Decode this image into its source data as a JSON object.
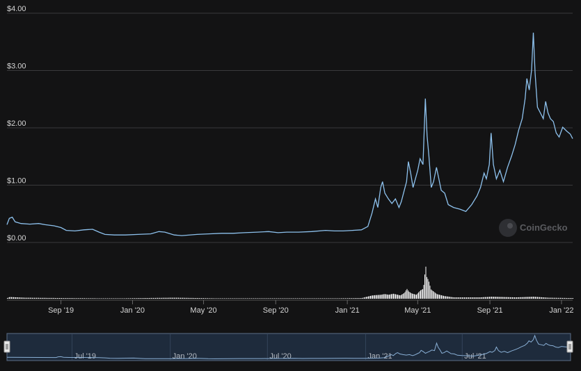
{
  "colors": {
    "background": "#131314",
    "price_line": "#8ec2ee",
    "volume_bars": "#ffffff",
    "grid": "#3a3a3c",
    "navigator_fill": "#1e2b3c",
    "navigator_border": "#5b6c86"
  },
  "watermark": {
    "text": "CoinGecko",
    "icon": "coingecko-logo-icon"
  },
  "chart_data": {
    "type": "line",
    "ylim": [
      0,
      4
    ],
    "y_ticks": [
      "$0.00",
      "$1.00",
      "$2.00",
      "$3.00",
      "$4.00"
    ],
    "x_ticks": [
      "Sep '19",
      "Jan '20",
      "May '20",
      "Sep '20",
      "Jan '21",
      "May '21",
      "Sep '21",
      "Jan '22"
    ],
    "xlim": [
      "2019-06-01",
      "2022-01-20"
    ],
    "grid": true,
    "series": [
      {
        "values_type": "price",
        "points": [
          [
            "2019-06-01",
            0.25
          ],
          [
            "2019-06-05",
            0.36
          ],
          [
            "2019-06-10",
            0.38
          ],
          [
            "2019-06-15",
            0.3
          ],
          [
            "2019-06-25",
            0.27
          ],
          [
            "2019-07-10",
            0.26
          ],
          [
            "2019-07-25",
            0.27
          ],
          [
            "2019-08-05",
            0.25
          ],
          [
            "2019-08-20",
            0.23
          ],
          [
            "2019-09-01",
            0.2
          ],
          [
            "2019-09-10",
            0.15
          ],
          [
            "2019-09-25",
            0.14
          ],
          [
            "2019-10-10",
            0.16
          ],
          [
            "2019-10-25",
            0.17
          ],
          [
            "2019-11-05",
            0.12
          ],
          [
            "2019-11-15",
            0.08
          ],
          [
            "2019-12-01",
            0.07
          ],
          [
            "2019-12-20",
            0.07
          ],
          [
            "2020-01-10",
            0.08
          ],
          [
            "2020-02-01",
            0.09
          ],
          [
            "2020-02-15",
            0.13
          ],
          [
            "2020-02-25",
            0.12
          ],
          [
            "2020-03-12",
            0.07
          ],
          [
            "2020-03-25",
            0.06
          ],
          [
            "2020-04-20",
            0.08
          ],
          [
            "2020-05-10",
            0.09
          ],
          [
            "2020-06-01",
            0.1
          ],
          [
            "2020-06-20",
            0.1
          ],
          [
            "2020-07-10",
            0.11
          ],
          [
            "2020-08-01",
            0.12
          ],
          [
            "2020-08-20",
            0.13
          ],
          [
            "2020-09-05",
            0.11
          ],
          [
            "2020-09-20",
            0.12
          ],
          [
            "2020-10-10",
            0.12
          ],
          [
            "2020-11-01",
            0.13
          ],
          [
            "2020-11-25",
            0.15
          ],
          [
            "2020-12-10",
            0.14
          ],
          [
            "2020-12-25",
            0.14
          ],
          [
            "2021-01-10",
            0.15
          ],
          [
            "2021-01-25",
            0.16
          ],
          [
            "2021-02-05",
            0.22
          ],
          [
            "2021-02-12",
            0.45
          ],
          [
            "2021-02-18",
            0.7
          ],
          [
            "2021-02-22",
            0.55
          ],
          [
            "2021-02-27",
            0.9
          ],
          [
            "2021-03-02",
            1.0
          ],
          [
            "2021-03-06",
            0.8
          ],
          [
            "2021-03-12",
            0.7
          ],
          [
            "2021-03-18",
            0.62
          ],
          [
            "2021-03-24",
            0.7
          ],
          [
            "2021-03-30",
            0.55
          ],
          [
            "2021-04-03",
            0.65
          ],
          [
            "2021-04-08",
            0.85
          ],
          [
            "2021-04-12",
            1.0
          ],
          [
            "2021-04-15",
            1.35
          ],
          [
            "2021-04-19",
            1.15
          ],
          [
            "2021-04-23",
            0.9
          ],
          [
            "2021-04-27",
            1.05
          ],
          [
            "2021-05-01",
            1.2
          ],
          [
            "2021-05-05",
            1.4
          ],
          [
            "2021-05-10",
            1.3
          ],
          [
            "2021-05-14",
            2.45
          ],
          [
            "2021-05-17",
            1.8
          ],
          [
            "2021-05-20",
            1.45
          ],
          [
            "2021-05-24",
            0.9
          ],
          [
            "2021-05-28",
            1.0
          ],
          [
            "2021-06-02",
            1.25
          ],
          [
            "2021-06-06",
            1.05
          ],
          [
            "2021-06-10",
            0.85
          ],
          [
            "2021-06-16",
            0.8
          ],
          [
            "2021-06-22",
            0.6
          ],
          [
            "2021-07-01",
            0.55
          ],
          [
            "2021-07-12",
            0.52
          ],
          [
            "2021-07-22",
            0.48
          ],
          [
            "2021-08-01",
            0.6
          ],
          [
            "2021-08-10",
            0.75
          ],
          [
            "2021-08-16",
            0.9
          ],
          [
            "2021-08-22",
            1.15
          ],
          [
            "2021-08-26",
            1.05
          ],
          [
            "2021-08-31",
            1.3
          ],
          [
            "2021-09-03",
            1.85
          ],
          [
            "2021-09-07",
            1.3
          ],
          [
            "2021-09-12",
            1.05
          ],
          [
            "2021-09-18",
            1.2
          ],
          [
            "2021-09-24",
            1.0
          ],
          [
            "2021-10-01",
            1.25
          ],
          [
            "2021-10-08",
            1.45
          ],
          [
            "2021-10-14",
            1.65
          ],
          [
            "2021-10-20",
            1.9
          ],
          [
            "2021-10-26",
            2.1
          ],
          [
            "2021-10-31",
            2.45
          ],
          [
            "2021-11-03",
            2.8
          ],
          [
            "2021-11-07",
            2.6
          ],
          [
            "2021-11-11",
            2.95
          ],
          [
            "2021-11-14",
            3.6
          ],
          [
            "2021-11-17",
            2.9
          ],
          [
            "2021-11-21",
            2.3
          ],
          [
            "2021-11-26",
            2.2
          ],
          [
            "2021-12-01",
            2.1
          ],
          [
            "2021-12-05",
            2.4
          ],
          [
            "2021-12-09",
            2.2
          ],
          [
            "2021-12-13",
            2.1
          ],
          [
            "2021-12-18",
            2.05
          ],
          [
            "2021-12-23",
            1.85
          ],
          [
            "2021-12-28",
            1.78
          ],
          [
            "2022-01-03",
            1.95
          ],
          [
            "2022-01-10",
            1.88
          ],
          [
            "2022-01-16",
            1.83
          ],
          [
            "2022-01-20",
            1.75
          ]
        ]
      },
      {
        "values_type": "volume_relative",
        "points": [
          [
            "2019-06-01",
            0.02
          ],
          [
            "2019-06-05",
            0.05
          ],
          [
            "2019-07-01",
            0.03
          ],
          [
            "2019-09-01",
            0.02
          ],
          [
            "2019-12-01",
            0.01
          ],
          [
            "2020-03-12",
            0.03
          ],
          [
            "2020-06-01",
            0.01
          ],
          [
            "2020-09-01",
            0.01
          ],
          [
            "2020-12-01",
            0.01
          ],
          [
            "2021-01-25",
            0.02
          ],
          [
            "2021-02-12",
            0.1
          ],
          [
            "2021-02-27",
            0.12
          ],
          [
            "2021-03-05",
            0.14
          ],
          [
            "2021-03-12",
            0.12
          ],
          [
            "2021-03-20",
            0.15
          ],
          [
            "2021-04-01",
            0.1
          ],
          [
            "2021-04-08",
            0.18
          ],
          [
            "2021-04-12",
            0.3
          ],
          [
            "2021-04-15",
            0.22
          ],
          [
            "2021-04-20",
            0.16
          ],
          [
            "2021-04-28",
            0.12
          ],
          [
            "2021-05-05",
            0.25
          ],
          [
            "2021-05-10",
            0.3
          ],
          [
            "2021-05-14",
            1.0
          ],
          [
            "2021-05-16",
            0.65
          ],
          [
            "2021-05-19",
            0.55
          ],
          [
            "2021-05-23",
            0.28
          ],
          [
            "2021-06-02",
            0.14
          ],
          [
            "2021-06-15",
            0.08
          ],
          [
            "2021-07-01",
            0.04
          ],
          [
            "2021-08-15",
            0.04
          ],
          [
            "2021-09-03",
            0.06
          ],
          [
            "2021-10-15",
            0.04
          ],
          [
            "2021-11-14",
            0.06
          ],
          [
            "2021-12-10",
            0.03
          ],
          [
            "2022-01-15",
            0.02
          ]
        ]
      }
    ]
  },
  "navigator": {
    "ticks": [
      "Jul '19",
      "Jan '20",
      "Jul '20",
      "Jan '21",
      "Jul '21"
    ]
  }
}
